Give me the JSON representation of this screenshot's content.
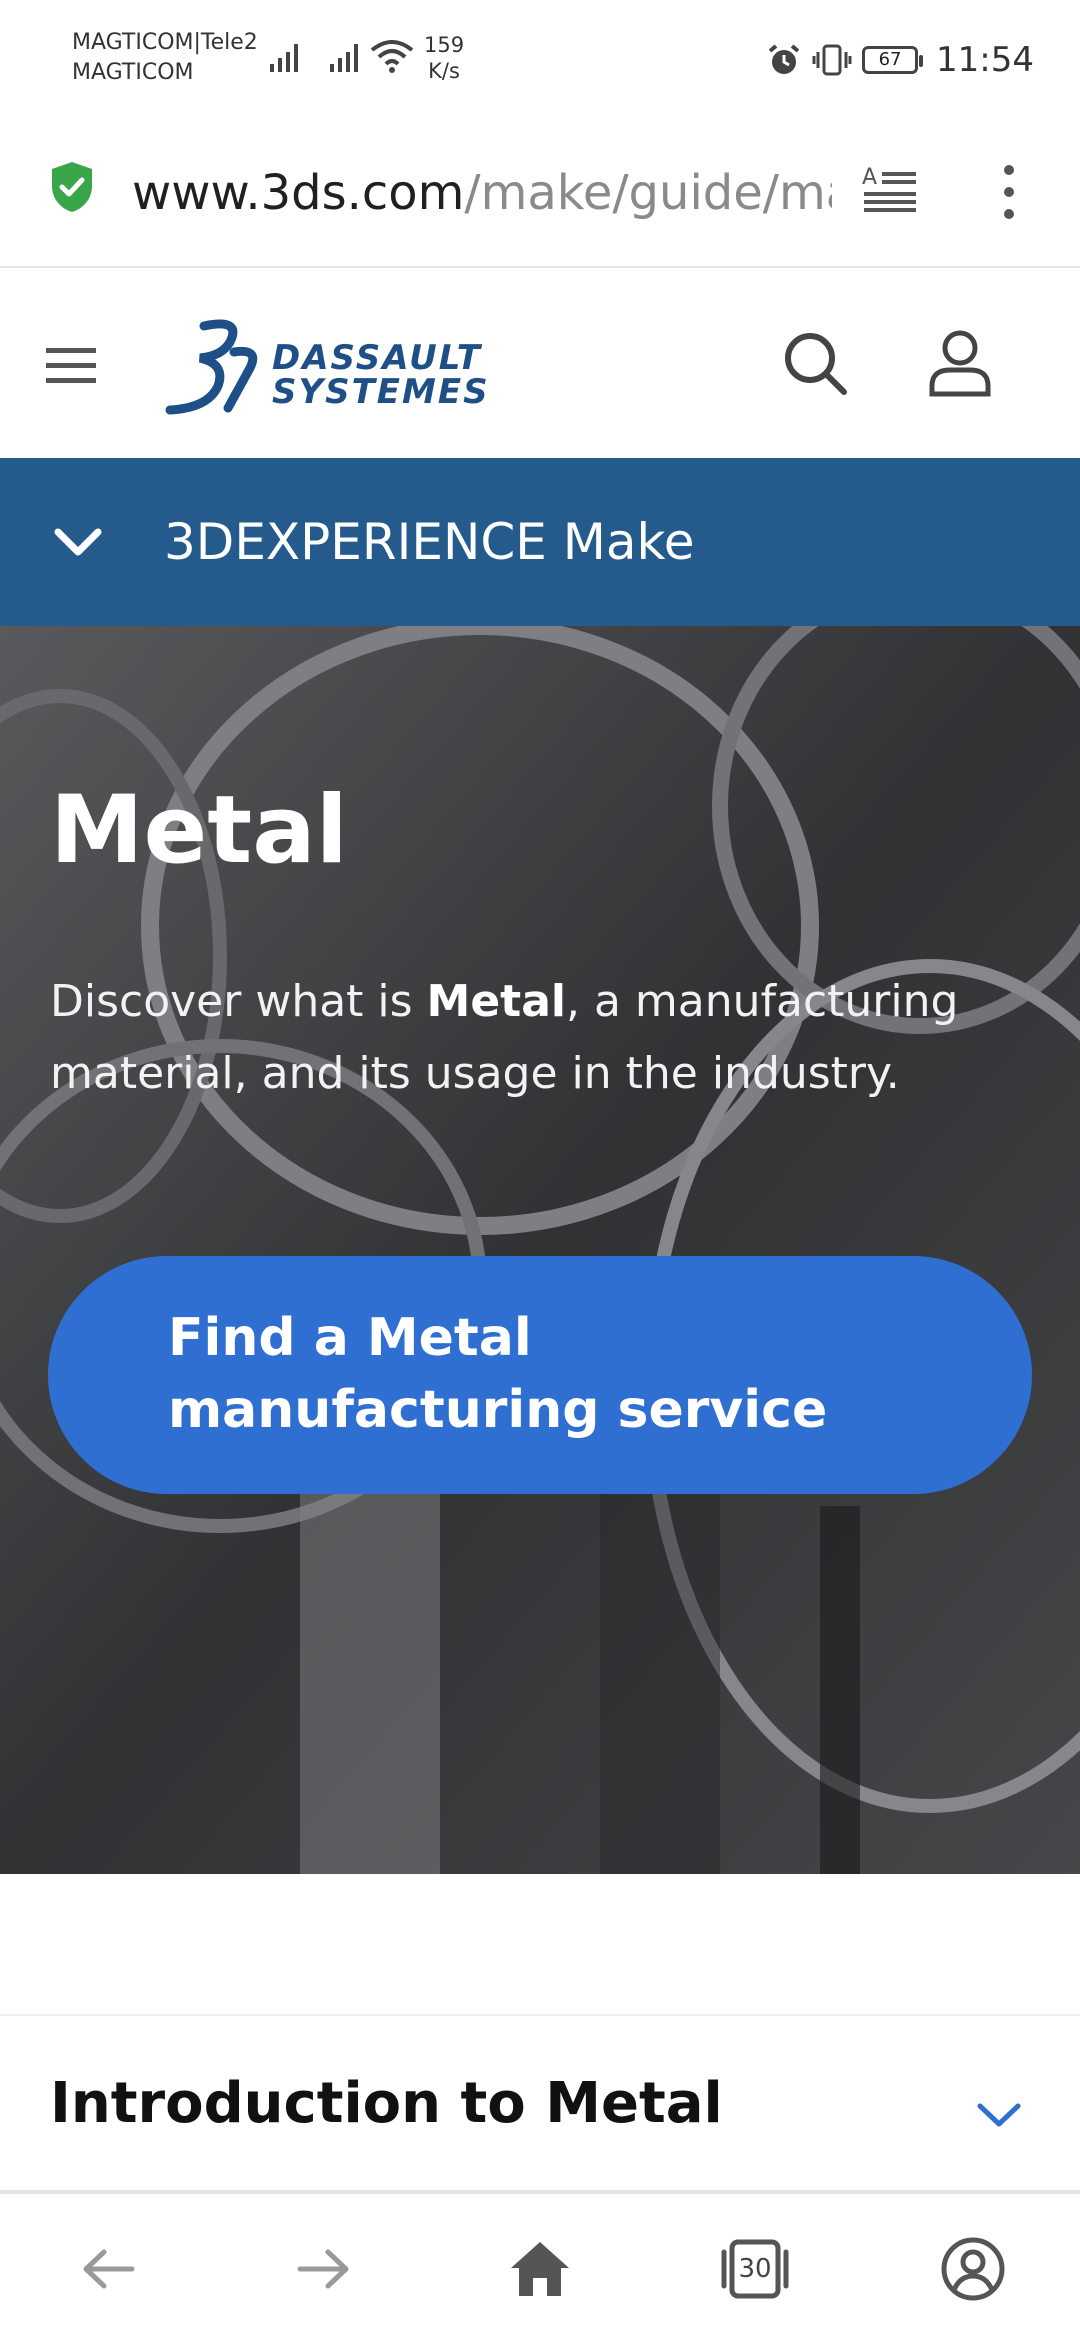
{
  "status_bar": {
    "carrier_line1": "MAGTICOM|Tele2",
    "carrier_line2": "MAGTICOM",
    "speed_value": "159",
    "speed_unit": "K/s",
    "battery": "67",
    "time": "11:54"
  },
  "browser": {
    "url_domain": "www.3ds.com",
    "url_path": "/make/guide/material/metal"
  },
  "header": {
    "logo_line1": "DASSAULT",
    "logo_line2": "SYSTEMES"
  },
  "product_bar": {
    "label": "3DEXPERIENCE Make"
  },
  "hero": {
    "title": "Metal",
    "desc_prefix": "Discover what is ",
    "desc_bold": "Metal",
    "desc_suffix": ", a manufacturing material, and its usage in the industry.",
    "cta_label": "Find a Metal manufacturing service"
  },
  "section": {
    "title": "Introduction to Metal"
  },
  "bottom_nav": {
    "tabs_count": "30"
  },
  "colors": {
    "brand_blue": "#255a8c",
    "cta_blue": "#2f6fd1",
    "shield_green": "#3aa64a"
  }
}
